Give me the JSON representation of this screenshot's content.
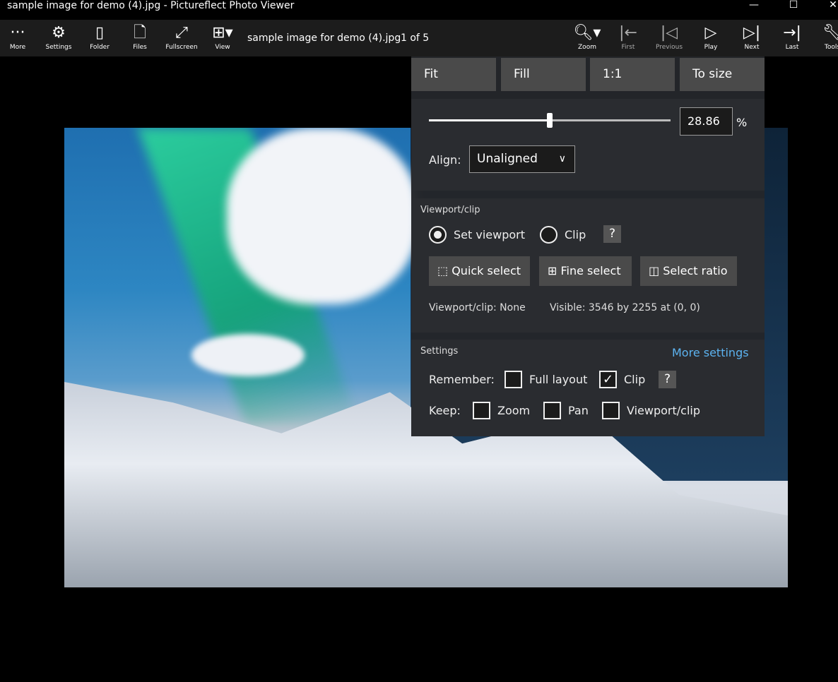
{
  "window": {
    "title": "sample image for demo (4).jpg - Pictureflect Photo Viewer",
    "minimize": "—",
    "maximize": "☐",
    "close": "✕"
  },
  "toolbar": {
    "left": [
      {
        "label": "More",
        "icon": "more-icon",
        "glyph": "···"
      },
      {
        "label": "Settings",
        "icon": "gear-icon",
        "glyph": "⚙"
      },
      {
        "label": "Folder",
        "icon": "folder-icon",
        "glyph": "▯"
      },
      {
        "label": "Files",
        "icon": "files-icon",
        "glyph": "🗋"
      },
      {
        "label": "Fullscreen",
        "icon": "fullscreen-icon",
        "glyph": "⤢"
      },
      {
        "label": "View",
        "icon": "view-grid-icon",
        "glyph": "⊞▾"
      }
    ],
    "file_name": "sample image for demo (4).jpg",
    "position": "1 of 5",
    "right": [
      {
        "label": "Zoom",
        "icon": "zoom-icon",
        "glyph": "🔍︎▾"
      },
      {
        "label": "First",
        "icon": "first-icon",
        "glyph": "|←",
        "disabled": true
      },
      {
        "label": "Previous",
        "icon": "previous-icon",
        "glyph": "|◁",
        "disabled": true
      },
      {
        "label": "Play",
        "icon": "play-icon",
        "glyph": "▷"
      },
      {
        "label": "Next",
        "icon": "next-icon",
        "glyph": "▷|"
      },
      {
        "label": "Last",
        "icon": "last-icon",
        "glyph": "→|"
      },
      {
        "label": "Tools",
        "icon": "wrench-icon",
        "glyph": "🔧︎"
      }
    ]
  },
  "zoom_panel": {
    "modes": [
      "Fit",
      "Fill",
      "1:1",
      "To size"
    ],
    "zoom_value": "28.86",
    "zoom_unit": "%",
    "slider_fraction": 0.5,
    "align_label": "Align:",
    "align_value": "Unaligned",
    "viewport": {
      "heading": "Viewport/clip",
      "radio_set_viewport": "Set viewport",
      "radio_clip": "Clip",
      "selected": "Set viewport",
      "help": "?",
      "buttons": [
        "Quick select",
        "Fine select",
        "Select ratio"
      ],
      "status_label": "Viewport/clip:",
      "status_value": "None",
      "visible": "Visible: 3546 by 2255 at (0, 0)"
    },
    "settings": {
      "heading": "Settings",
      "more_link": "More settings",
      "remember_label": "Remember:",
      "full_layout": "Full layout",
      "full_layout_checked": false,
      "clip": "Clip",
      "clip_checked": true,
      "help": "?",
      "keep_label": "Keep:",
      "zoom": "Zoom",
      "pan": "Pan",
      "viewport_clip": "Viewport/clip"
    }
  },
  "colors": {
    "accent_link": "#5cb3f0",
    "button": "#4a4a4a",
    "panel": "#2a2c30"
  }
}
